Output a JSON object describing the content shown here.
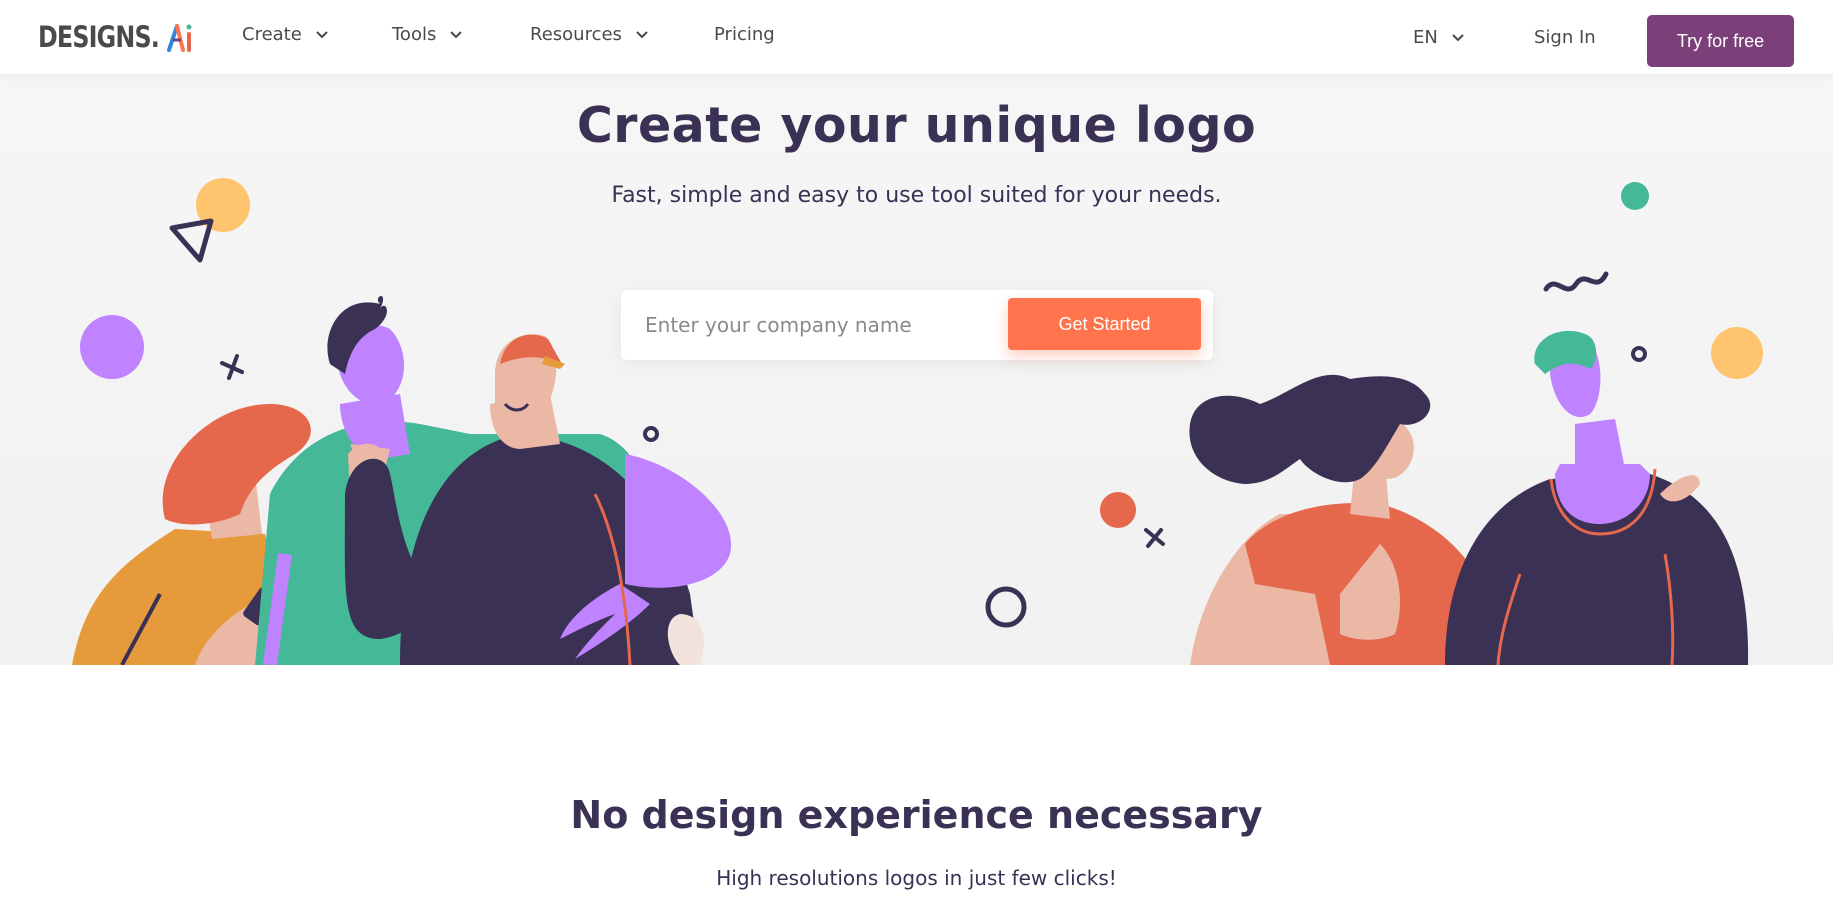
{
  "brand": {
    "name": "DESIGNS.AI",
    "logo_text": "DESIGNS.",
    "icon": "ai-logo-icon"
  },
  "nav": {
    "items": [
      {
        "label": "Create",
        "has_dropdown": true
      },
      {
        "label": "Tools",
        "has_dropdown": true
      },
      {
        "label": "Resources",
        "has_dropdown": true
      },
      {
        "label": "Pricing",
        "has_dropdown": false
      }
    ],
    "language": "EN",
    "sign_in": "Sign In",
    "cta": "Try for free"
  },
  "hero": {
    "title": "Create your unique logo",
    "subtitle": "Fast, simple and easy to use tool suited for your needs.",
    "input_placeholder": "Enter your company name",
    "button": "Get Started"
  },
  "section": {
    "title": "No design experience necessary",
    "subtitle": "High resolutions logos in just few clicks!"
  },
  "colors": {
    "primary_purple": "#7b3f7a",
    "accent_orange": "#ff744c",
    "text_dark": "#3a3155",
    "green": "#44b897",
    "lilac": "#c083ff",
    "yellow": "#ffc46e",
    "coral": "#e5674c"
  }
}
